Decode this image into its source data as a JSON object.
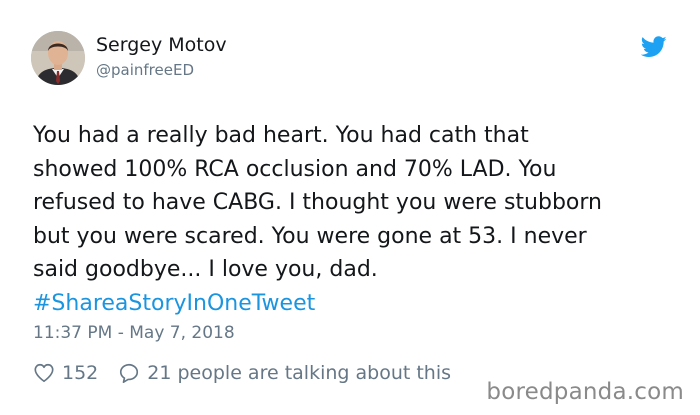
{
  "author": {
    "name": "Sergey Motov",
    "handle": "@painfreeED"
  },
  "tweet": {
    "lines": [
      "You had a really bad heart. You had cath that",
      "showed 100% RCA occlusion and 70% LAD. You",
      "refused to have CABG. I thought you were stubborn",
      "but you were scared. You were gone at 53. I never",
      "said goodbye... I love you, dad."
    ],
    "hashtag": "#ShareaStoryInOneTweet",
    "timestamp": "11:37 PM - May 7, 2018"
  },
  "engagement": {
    "likes": "152",
    "conversation": "21 people are talking about this"
  },
  "watermark": "boredpanda.com",
  "icons": {
    "brand": "twitter-bird-icon",
    "like": "heart-outline-icon",
    "reply": "speech-bubble-outline-icon"
  },
  "colors": {
    "text": "#14171a",
    "muted": "#657786",
    "accent": "#1da1f2",
    "hashtag": "#1b95e0",
    "watermark": "#8a8a8a"
  }
}
